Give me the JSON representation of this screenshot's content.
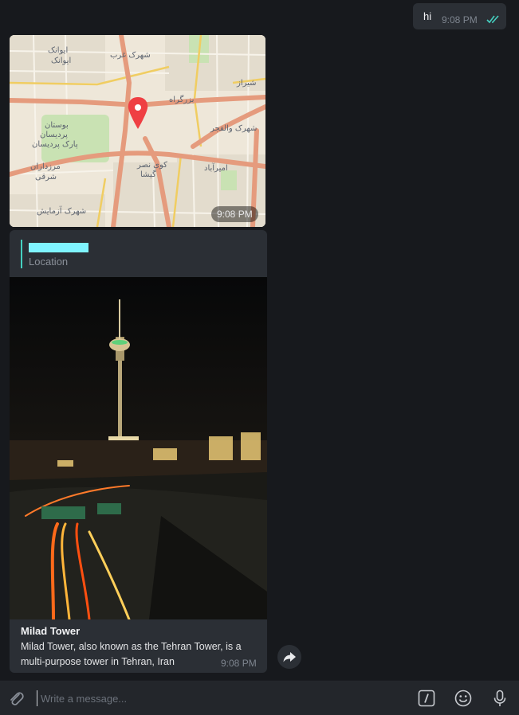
{
  "colors": {
    "background": "#17191d",
    "bubble": "#2b2f35",
    "accent": "#45d0c0",
    "pin": "#ef3f43"
  },
  "outgoing": {
    "text": "hi",
    "time": "9:08 PM",
    "status_icon": "double-check-icon"
  },
  "map_message": {
    "time": "9:08 PM",
    "icon": "map-pin-icon",
    "labels": [
      "ایوانک",
      "ایوانک",
      "شهرک غرب",
      "بزرگراه",
      "شیراز",
      "بوستان",
      "پردیسان",
      "پارک پردیسان",
      "مرزداران",
      "شرقی",
      "کوی نصر",
      "گیشا",
      "امیرآباد",
      "شهرک والفجر",
      "شهرک آزمایش"
    ]
  },
  "venue_message": {
    "reply_label": "Location",
    "title": "Milad Tower",
    "description": " Milad Tower, also known as the Tehran Tower, is a multi-purpose tower in Tehran, Iran",
    "time": "9:08 PM"
  },
  "composer": {
    "placeholder": "Write a message...",
    "icons": [
      "paperclip-icon",
      "bot-command-icon",
      "emoji-icon",
      "microphone-icon"
    ]
  },
  "forward_icon": "forward-icon"
}
